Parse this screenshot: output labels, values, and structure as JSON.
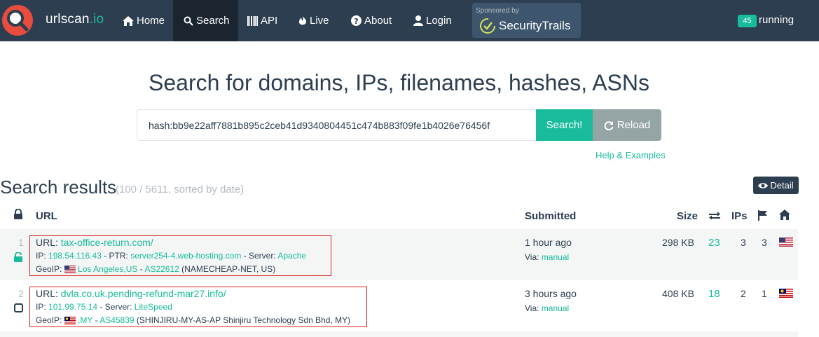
{
  "brand": {
    "name": "urlscan",
    "suffix": ".io"
  },
  "nav": {
    "home": "Home",
    "search": "Search",
    "api": "API",
    "live": "Live",
    "about": "About",
    "login": "Login"
  },
  "sponsor": {
    "label": "Sponsored by",
    "name": "SecurityTrails"
  },
  "running": {
    "count": "45",
    "label": "running"
  },
  "headline": "Search for domains, IPs, filenames, hashes, ASNs",
  "search": {
    "value": "hash:bb9e22aff7881b895c2ceb41d9340804451c474b883f09fe1b4026e76456f",
    "button": "Search!",
    "reload": "Reload",
    "help": "Help & Examples"
  },
  "results": {
    "title": "Search results",
    "meta": "(100 / 5611, sorted by date)",
    "detail_button": "Detail"
  },
  "table": {
    "headers": {
      "url": "URL",
      "submitted": "Submitted",
      "size": "Size",
      "ips": "IPs"
    },
    "rows": [
      {
        "num": "1",
        "url_label": "URL:",
        "url": "tax-office-return.com/",
        "ip_label": "IP:",
        "ip": "198.54.116.43",
        "ptr_sep": " - ",
        "ptr_label": "PTR:",
        "ptr": "server254-4.web-hosting.com",
        "server_sep": " - ",
        "server_label": "Server:",
        "server": "Apache",
        "geo_label": "GeoIP:",
        "geo_location": "Los Angeles,US",
        "geo_sep": " - ",
        "asn": "AS22612",
        "asn_name": " (NAMECHEAP-NET, US)",
        "submitted": "1 hour ago",
        "via_label": "Via:",
        "via": "manual",
        "size": "298 KB",
        "requests": "23",
        "ips": "3",
        "countries": "3",
        "flag": "us"
      },
      {
        "num": "2",
        "url_label": "URL:",
        "url": "dvla.co.uk.pending-refund-mar27.info/",
        "ip_label": "IP:",
        "ip": "101.99.75.14",
        "server_sep": " - ",
        "server_label": "Server:",
        "server": "LiteSpeed",
        "geo_label": "GeoIP:",
        "geo_location": ",MY",
        "geo_sep": " - ",
        "asn": "AS45839",
        "asn_name": " (SHINJIRU-MY-AS-AP Shinjiru Technology Sdn Bhd, MY)",
        "submitted": "3 hours ago",
        "via_label": "Via:",
        "via": "manual",
        "size": "408 KB",
        "requests": "18",
        "ips": "2",
        "countries": "1",
        "flag": "my"
      }
    ]
  },
  "colors": {
    "nav_bg": "#2c3e50",
    "accent": "#18bc9c",
    "highlight_border": "#d9241e",
    "muted": "#b4bcc2"
  },
  "icons": [
    "magnifier-logo-icon",
    "home-icon",
    "search-icon",
    "barcode-icon",
    "fire-icon",
    "question-circle-icon",
    "user-icon",
    "checkmark-circle-icon",
    "refresh-icon",
    "eye-icon",
    "lock-icon",
    "exchange-icon",
    "flag-icon",
    "house-icon",
    "us-flag-icon",
    "my-flag-icon",
    "unlocked-icon",
    "checkbox-icon"
  ]
}
